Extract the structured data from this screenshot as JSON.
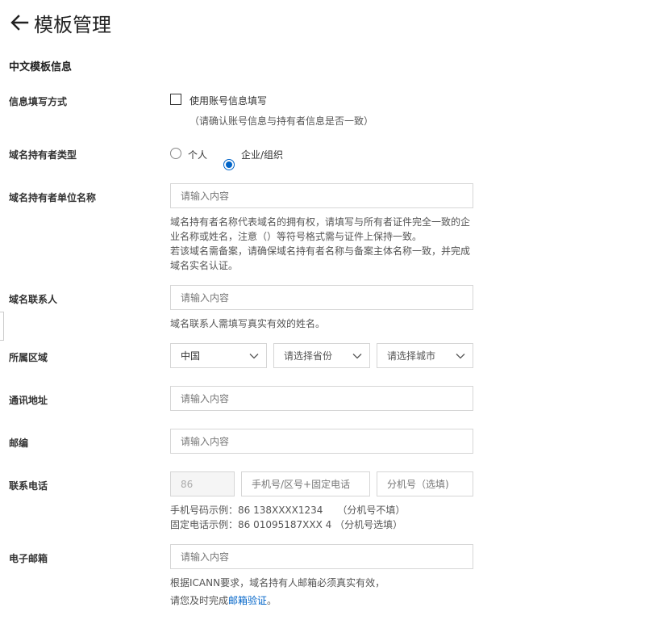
{
  "header": {
    "title": "模板管理"
  },
  "section_title": "中文模板信息",
  "fill_method": {
    "label": "信息填写方式",
    "checkbox_label": "使用账号信息填写",
    "hint": "（请确认账号信息与持有者信息是否一致）"
  },
  "owner_type": {
    "label": "域名持有者类型",
    "options": [
      "个人",
      "企业/组织"
    ],
    "selected": "企业/组织"
  },
  "owner_name": {
    "label": "域名持有者单位名称",
    "placeholder": "请输入内容",
    "hint_lines": [
      "域名持有者名称代表域名的拥有权，请填写与所有者证件完全一致的企",
      "业名称或姓名，注意（）等符号格式需与证件上保持一致。",
      "若该域名需备案，请确保域名持有者名称与备案主体名称一致，并完成",
      "域名实名认证。"
    ]
  },
  "contact": {
    "label": "域名联系人",
    "placeholder": "请输入内容",
    "hint": "域名联系人需填写真实有效的姓名。"
  },
  "region": {
    "label": "所属区域",
    "country": "中国",
    "province_placeholder": "请选择省份",
    "city_placeholder": "请选择城市"
  },
  "address": {
    "label": "通讯地址",
    "placeholder": "请输入内容"
  },
  "postcode": {
    "label": "邮编",
    "placeholder": "请输入内容"
  },
  "phone": {
    "label": "联系电话",
    "country_code": "86",
    "number_placeholder": "手机号/区号+固定电话",
    "ext_placeholder": "分机号（选填)",
    "example_mobile": "手机号码示例：86 138XXXX1234　　（分机号不填）",
    "example_landline": "固定电话示例：86 01095187XXX 4 （分机号选填）"
  },
  "email": {
    "label": "电子邮箱",
    "placeholder": "请输入内容",
    "hint_line1": "根据ICANN要求，域名持有人邮箱必须真实有效，",
    "hint_line2_prefix": "请您及时完成",
    "hint_link": "邮箱验证",
    "hint_line2_suffix": "。"
  }
}
